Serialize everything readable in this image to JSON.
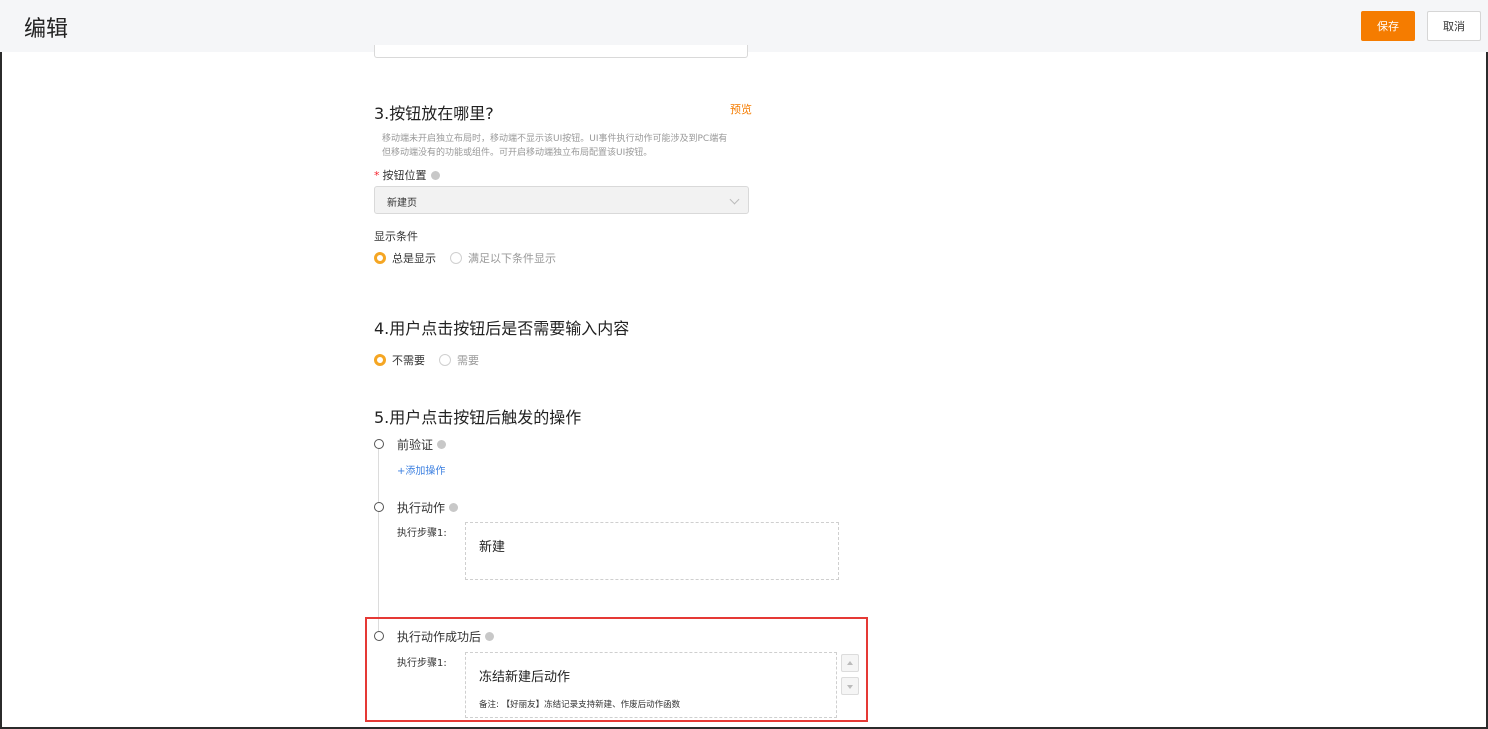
{
  "header": {
    "title": "编辑",
    "save_label": "保存",
    "cancel_label": "取消"
  },
  "section3": {
    "title": "3.按钮放在哪里?",
    "preview_label": "预览",
    "help_line1": "移动端未开启独立布局时，移动端不显示该UI按钮。UI事件执行动作可能涉及到PC端有",
    "help_line2": "但移动端没有的功能或组件。可开启移动端独立布局配置该UI按钮。",
    "position_label": "按钮位置",
    "position_required": "*",
    "position_value": "新建页",
    "display_condition_label": "显示条件",
    "display_options": [
      {
        "label": "总是显示",
        "selected": true
      },
      {
        "label": "满足以下条件显示",
        "selected": false
      }
    ]
  },
  "section4": {
    "title": "4.用户点击按钮后是否需要输入内容",
    "options": [
      {
        "label": "不需要",
        "selected": true
      },
      {
        "label": "需要",
        "selected": false
      }
    ]
  },
  "section5": {
    "title": "5.用户点击按钮后触发的操作",
    "pre_validation": {
      "title": "前验证",
      "add_label": "+添加操作"
    },
    "execute_action": {
      "title": "执行动作",
      "step_label": "执行步骤1:",
      "step_name": "新建"
    },
    "after_success": {
      "title": "执行动作成功后",
      "step_label": "执行步骤1:",
      "step_name": "冻结新建后动作",
      "note": "备注: 【好丽友】冻结记录支持新建、作废后动作函数"
    }
  },
  "colors": {
    "accent": "#f57c00",
    "link": "#3b7fe0",
    "highlight": "#e53935"
  }
}
